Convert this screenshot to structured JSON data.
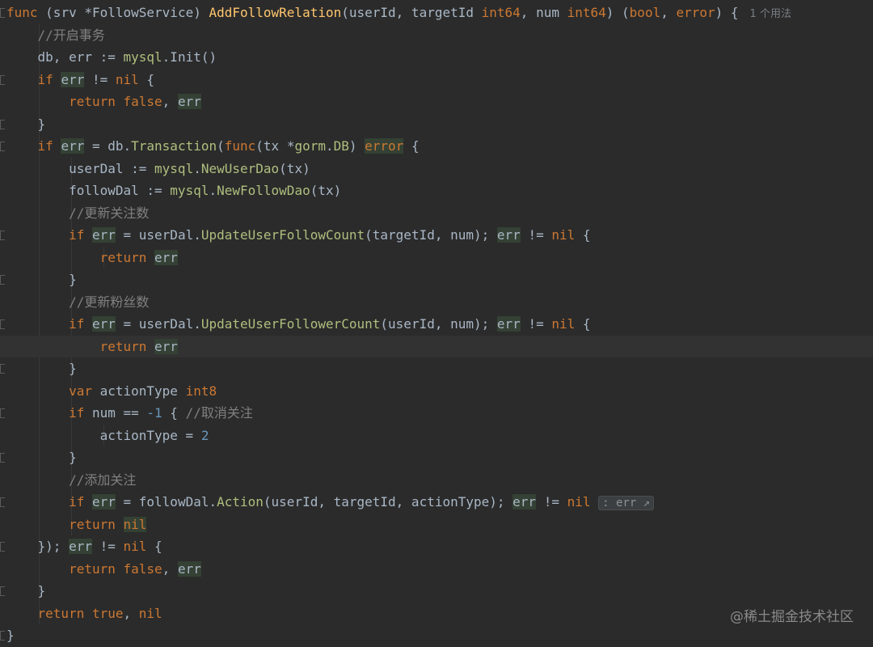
{
  "editor": {
    "lines": [
      [
        {
          "t": "func ",
          "c": "t-kw"
        },
        {
          "t": "(srv ",
          "c": "t-plain"
        },
        {
          "t": "*FollowService",
          "c": "t-plain"
        },
        {
          "t": ") ",
          "c": "t-plain"
        },
        {
          "t": "AddFollowRelation",
          "c": "t-fn"
        },
        {
          "t": "(userId, targetId ",
          "c": "t-plain"
        },
        {
          "t": "int64",
          "c": "t-type"
        },
        {
          "t": ", num ",
          "c": "t-plain"
        },
        {
          "t": "int64",
          "c": "t-type"
        },
        {
          "t": ") (",
          "c": "t-plain"
        },
        {
          "t": "bool",
          "c": "t-type"
        },
        {
          "t": ", ",
          "c": "t-plain"
        },
        {
          "t": "error",
          "c": "t-type"
        },
        {
          "t": ") {",
          "c": "t-plain"
        },
        {
          "t": "1 个用法",
          "c": "hint"
        }
      ],
      [
        {
          "t": "    //开启事务",
          "c": "t-cmt"
        }
      ],
      [
        {
          "t": "    db, ",
          "c": "t-plain"
        },
        {
          "t": "err",
          "c": "t-plain"
        },
        {
          "t": " := ",
          "c": "t-plain"
        },
        {
          "t": "mysql",
          "c": "t-pkg"
        },
        {
          "t": ".Init()",
          "c": "t-plain"
        }
      ],
      [
        {
          "t": "    ",
          "c": "t-plain"
        },
        {
          "t": "if ",
          "c": "t-kw"
        },
        {
          "t": "err",
          "c": "t-plain hl"
        },
        {
          "t": " != ",
          "c": "t-plain"
        },
        {
          "t": "nil",
          "c": "t-kw"
        },
        {
          "t": " {",
          "c": "t-plain"
        }
      ],
      [
        {
          "t": "        ",
          "c": "t-plain"
        },
        {
          "t": "return ",
          "c": "t-kw"
        },
        {
          "t": "false",
          "c": "t-kw"
        },
        {
          "t": ", ",
          "c": "t-plain"
        },
        {
          "t": "err",
          "c": "t-plain hl"
        }
      ],
      [
        {
          "t": "    }",
          "c": "t-plain"
        }
      ],
      [
        {
          "t": "    ",
          "c": "t-plain"
        },
        {
          "t": "if ",
          "c": "t-kw"
        },
        {
          "t": "err",
          "c": "t-plain hl"
        },
        {
          "t": " = db.",
          "c": "t-plain"
        },
        {
          "t": "Transaction",
          "c": "t-pkg"
        },
        {
          "t": "(",
          "c": "t-plain"
        },
        {
          "t": "func",
          "c": "t-kw"
        },
        {
          "t": "(tx *",
          "c": "t-plain"
        },
        {
          "t": "gorm",
          "c": "t-pkg"
        },
        {
          "t": ".",
          "c": "t-plain"
        },
        {
          "t": "DB",
          "c": "t-pkg"
        },
        {
          "t": ") ",
          "c": "t-plain"
        },
        {
          "t": "error",
          "c": "t-type hl"
        },
        {
          "t": " {",
          "c": "t-plain"
        }
      ],
      [
        {
          "t": "        userDal := ",
          "c": "t-plain"
        },
        {
          "t": "mysql",
          "c": "t-pkg"
        },
        {
          "t": ".",
          "c": "t-plain"
        },
        {
          "t": "NewUserDao",
          "c": "t-pkg"
        },
        {
          "t": "(tx)",
          "c": "t-plain"
        }
      ],
      [
        {
          "t": "        followDal := ",
          "c": "t-plain"
        },
        {
          "t": "mysql",
          "c": "t-pkg"
        },
        {
          "t": ".",
          "c": "t-plain"
        },
        {
          "t": "NewFollowDao",
          "c": "t-pkg"
        },
        {
          "t": "(tx)",
          "c": "t-plain"
        }
      ],
      [
        {
          "t": "        //更新关注数",
          "c": "t-cmt"
        }
      ],
      [
        {
          "t": "        ",
          "c": "t-plain"
        },
        {
          "t": "if ",
          "c": "t-kw"
        },
        {
          "t": "err",
          "c": "t-plain hl"
        },
        {
          "t": " = userDal.",
          "c": "t-plain"
        },
        {
          "t": "UpdateUserFollowCount",
          "c": "t-pkg"
        },
        {
          "t": "(targetId, num); ",
          "c": "t-plain"
        },
        {
          "t": "err",
          "c": "t-plain hl"
        },
        {
          "t": " != ",
          "c": "t-plain"
        },
        {
          "t": "nil",
          "c": "t-kw"
        },
        {
          "t": " {",
          "c": "t-plain"
        }
      ],
      [
        {
          "t": "            ",
          "c": "t-plain"
        },
        {
          "t": "return ",
          "c": "t-kw"
        },
        {
          "t": "err",
          "c": "t-plain hl"
        }
      ],
      [
        {
          "t": "        }",
          "c": "t-plain"
        }
      ],
      [
        {
          "t": "        //更新粉丝数",
          "c": "t-cmt"
        }
      ],
      [
        {
          "t": "        ",
          "c": "t-plain"
        },
        {
          "t": "if ",
          "c": "t-kw"
        },
        {
          "t": "err",
          "c": "t-plain hl"
        },
        {
          "t": " = userDal.",
          "c": "t-plain"
        },
        {
          "t": "UpdateUserFollowerCount",
          "c": "t-pkg"
        },
        {
          "t": "(userId, num); ",
          "c": "t-plain"
        },
        {
          "t": "err",
          "c": "t-plain hl"
        },
        {
          "t": " != ",
          "c": "t-plain"
        },
        {
          "t": "nil",
          "c": "t-kw"
        },
        {
          "t": " {",
          "c": "t-plain"
        }
      ],
      [
        {
          "t": "            ",
          "c": "t-plain"
        },
        {
          "t": "return ",
          "c": "t-kw"
        },
        {
          "t": "err",
          "c": "t-plain hl"
        }
      ],
      [
        {
          "t": "        }",
          "c": "t-plain"
        }
      ],
      [
        {
          "t": "        ",
          "c": "t-plain"
        },
        {
          "t": "var ",
          "c": "t-kw"
        },
        {
          "t": "actionType ",
          "c": "t-plain"
        },
        {
          "t": "int8",
          "c": "t-type"
        }
      ],
      [
        {
          "t": "        ",
          "c": "t-plain"
        },
        {
          "t": "if ",
          "c": "t-kw"
        },
        {
          "t": "num == ",
          "c": "t-plain"
        },
        {
          "t": "-1",
          "c": "t-num"
        },
        {
          "t": " { ",
          "c": "t-plain"
        },
        {
          "t": "//取消关注",
          "c": "t-cmt"
        }
      ],
      [
        {
          "t": "            actionType = ",
          "c": "t-plain"
        },
        {
          "t": "2",
          "c": "t-num"
        }
      ],
      [
        {
          "t": "        }",
          "c": "t-plain"
        }
      ],
      [
        {
          "t": "        //添加关注",
          "c": "t-cmt"
        }
      ],
      [
        {
          "t": "        ",
          "c": "t-plain"
        },
        {
          "t": "if ",
          "c": "t-kw"
        },
        {
          "t": "err",
          "c": "t-plain hl"
        },
        {
          "t": " = followDal.",
          "c": "t-plain"
        },
        {
          "t": "Action",
          "c": "t-pkg"
        },
        {
          "t": "(userId, targetId, actionType); ",
          "c": "t-plain"
        },
        {
          "t": "err",
          "c": "t-plain hl"
        },
        {
          "t": " != ",
          "c": "t-plain"
        },
        {
          "t": "nil",
          "c": "t-kw"
        },
        {
          "t": " ",
          "c": "t-plain"
        },
        {
          "t": ": err ↗",
          "c": "inlay"
        }
      ],
      [
        {
          "t": "        ",
          "c": "t-plain"
        },
        {
          "t": "return ",
          "c": "t-kw"
        },
        {
          "t": "nil",
          "c": "t-kw hl"
        }
      ],
      [
        {
          "t": "    }); ",
          "c": "t-plain"
        },
        {
          "t": "err",
          "c": "t-plain hl"
        },
        {
          "t": " != ",
          "c": "t-plain"
        },
        {
          "t": "nil",
          "c": "t-kw"
        },
        {
          "t": " {",
          "c": "t-plain"
        }
      ],
      [
        {
          "t": "        ",
          "c": "t-plain"
        },
        {
          "t": "return ",
          "c": "t-kw"
        },
        {
          "t": "false",
          "c": "t-kw"
        },
        {
          "t": ", ",
          "c": "t-plain"
        },
        {
          "t": "err",
          "c": "t-plain hl"
        }
      ],
      [
        {
          "t": "    }",
          "c": "t-plain"
        }
      ],
      [
        {
          "t": "    ",
          "c": "t-plain"
        },
        {
          "t": "return ",
          "c": "t-kw"
        },
        {
          "t": "true",
          "c": "t-kw"
        },
        {
          "t": ", ",
          "c": "t-plain"
        },
        {
          "t": "nil",
          "c": "t-kw"
        }
      ],
      [
        {
          "t": "}",
          "c": "t-plain"
        }
      ]
    ],
    "current_line": 15
  },
  "watermark": "@稀土掘金技术社区"
}
